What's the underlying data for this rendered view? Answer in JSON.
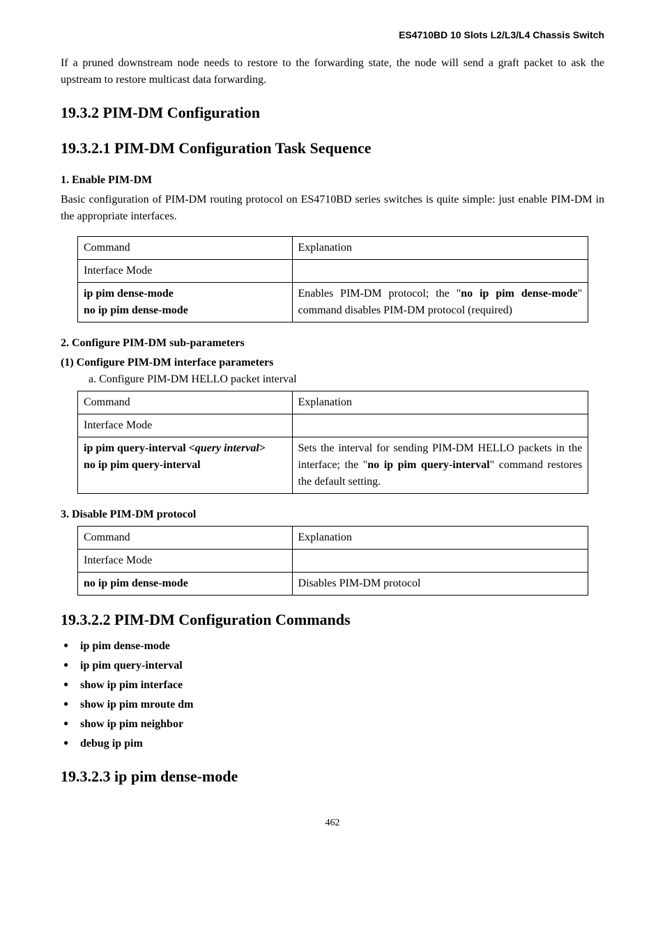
{
  "header": {
    "title": "ES4710BD 10 Slots L2/L3/L4 Chassis Switch"
  },
  "intro": "If a pruned downstream node needs to restore to the forwarding state, the node will send a graft packet to ask the upstream to restore multicast data forwarding.",
  "h_19_3_2": "19.3.2  PIM-DM Configuration",
  "h_19_3_2_1": "19.3.2.1  PIM-DM Configuration Task Sequence",
  "sec1": {
    "head": "1. Enable PIM-DM",
    "para": "Basic configuration of PIM-DM routing protocol on ES4710BD series switches is quite simple: just enable PIM-DM in the appropriate interfaces.",
    "table": {
      "r1c1": "Command",
      "r1c2": "Explanation",
      "r2c1": "Interface Mode",
      "r2c2": "",
      "r3c1_l1": "ip pim dense-mode",
      "r3c1_l2": "no ip pim dense-mode",
      "r3c2_pre": "Enables PIM-DM protocol; the \"",
      "r3c2_b1": "no ip pim dense-mode",
      "r3c2_mid": "\" command disables PIM-DM protocol (required)"
    }
  },
  "sec2": {
    "head": "2. Configure PIM-DM sub-parameters",
    "sub1": "(1) Configure PIM-DM interface parameters",
    "line_a": "a. Configure PIM-DM HELLO packet interval",
    "table": {
      "r1c1": "Command",
      "r1c2": "Explanation",
      "r2c1": "Interface Mode",
      "r2c2": "",
      "r3c1_b1": "ip pim query-interval <",
      "r3c1_i1": "query interval",
      "r3c1_b2": ">",
      "r3c1_l2": "no ip pim query-interval",
      "r3c2_pre": "Sets the interval for sending PIM-DM HELLO packets in the interface; the \"",
      "r3c2_b1": "no ip pim query-interval",
      "r3c2_mid": "\" command restores the default setting."
    }
  },
  "sec3": {
    "head": "3. Disable PIM-DM protocol",
    "table": {
      "r1c1": "Command",
      "r1c2": "Explanation",
      "r2c1": "Interface Mode",
      "r2c2": "",
      "r3c1": "no ip pim dense-mode",
      "r3c2": "Disables PIM-DM protocol"
    }
  },
  "h_19_3_2_2": "19.3.2.2  PIM-DM Configuration Commands",
  "cmdlist": [
    "ip pim dense-mode",
    "ip pim query-interval",
    "show ip pim interface",
    "show ip pim mroute dm",
    "show ip pim neighbor",
    "debug ip pim"
  ],
  "h_19_3_2_3": "19.3.2.3  ip pim dense-mode",
  "pagenum": "462"
}
